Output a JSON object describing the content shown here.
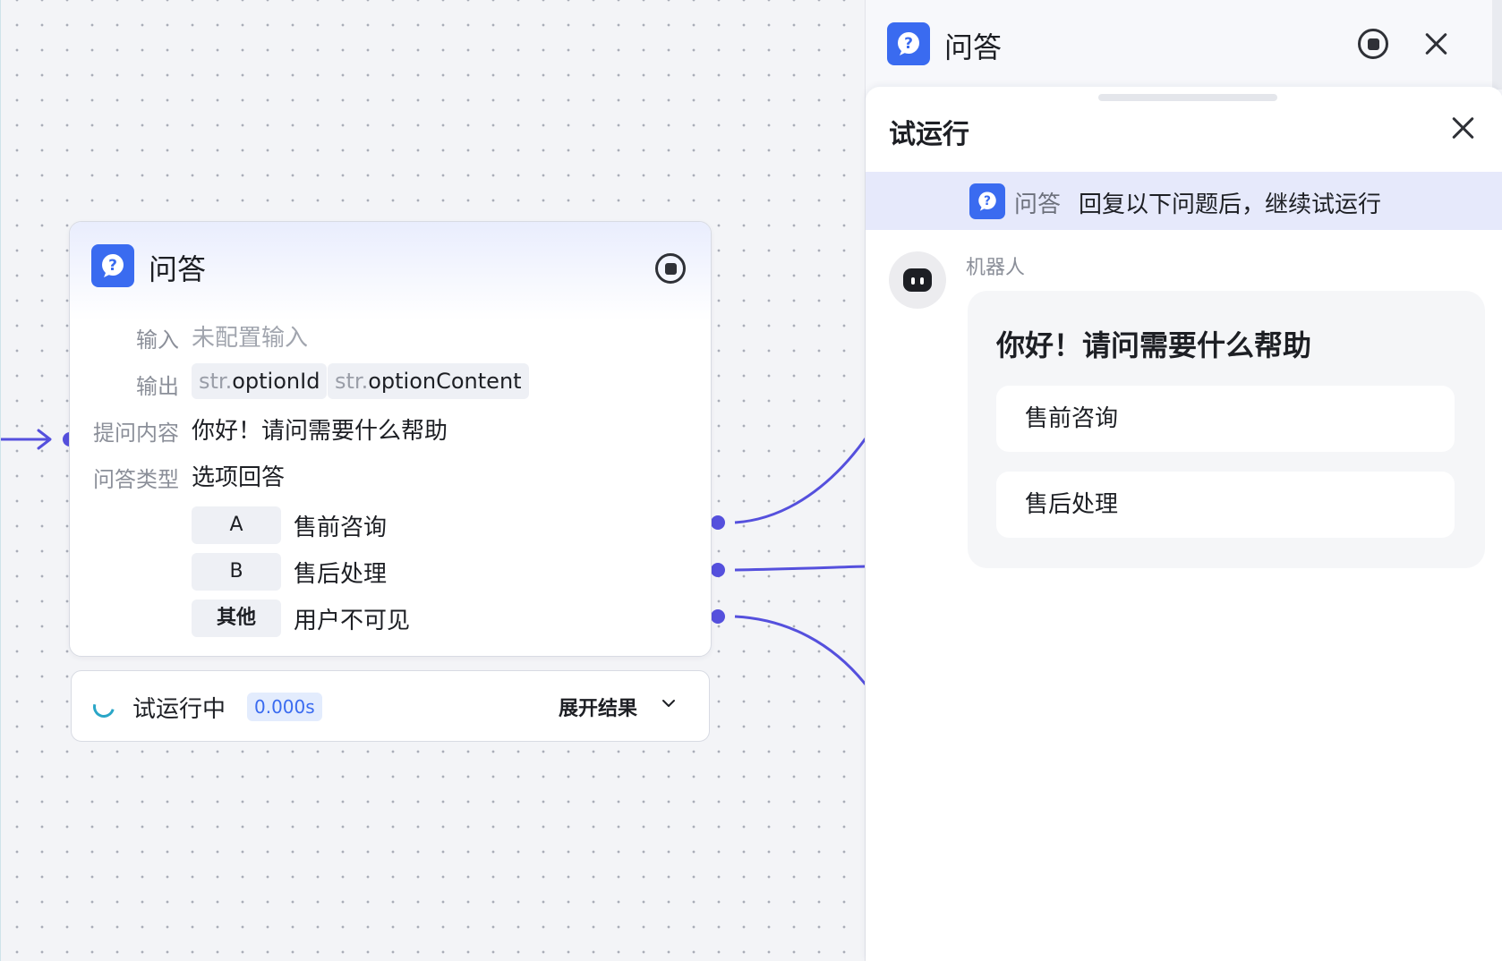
{
  "node": {
    "title": "问答",
    "rows": {
      "input_label": "输入",
      "input_value": "未配置输入",
      "output_label": "输出",
      "outputs": [
        {
          "type": "str.",
          "name": "optionId"
        },
        {
          "type": "str.",
          "name": "optionContent"
        }
      ],
      "question_label": "提问内容",
      "question_value": "你好！请问需要什么帮助",
      "answer_type_label": "问答类型",
      "answer_type_value": "选项回答"
    },
    "options": [
      {
        "key": "A",
        "text": "售前咨询"
      },
      {
        "key": "B",
        "text": "售后处理"
      },
      {
        "key": "其他",
        "text": "用户不可见"
      }
    ]
  },
  "run_status": {
    "label": "试运行中",
    "time": "0.000s",
    "expand_label": "展开结果"
  },
  "panel": {
    "title": "问答",
    "sheet": {
      "title": "试运行",
      "banner_node": "问答",
      "banner_text": "回复以下问题后，继续试运行",
      "bot_name": "机器人",
      "message": "你好！请问需要什么帮助",
      "options": [
        "售前咨询",
        "售后处理"
      ]
    }
  },
  "colors": {
    "accent": "#3a6bf0",
    "wire": "#5550dd",
    "banner_bg": "#e6e9fb"
  },
  "icons": [
    "question-icon",
    "stop-icon",
    "close-icon",
    "chevron-down-icon",
    "robot-icon",
    "spinner-icon"
  ]
}
